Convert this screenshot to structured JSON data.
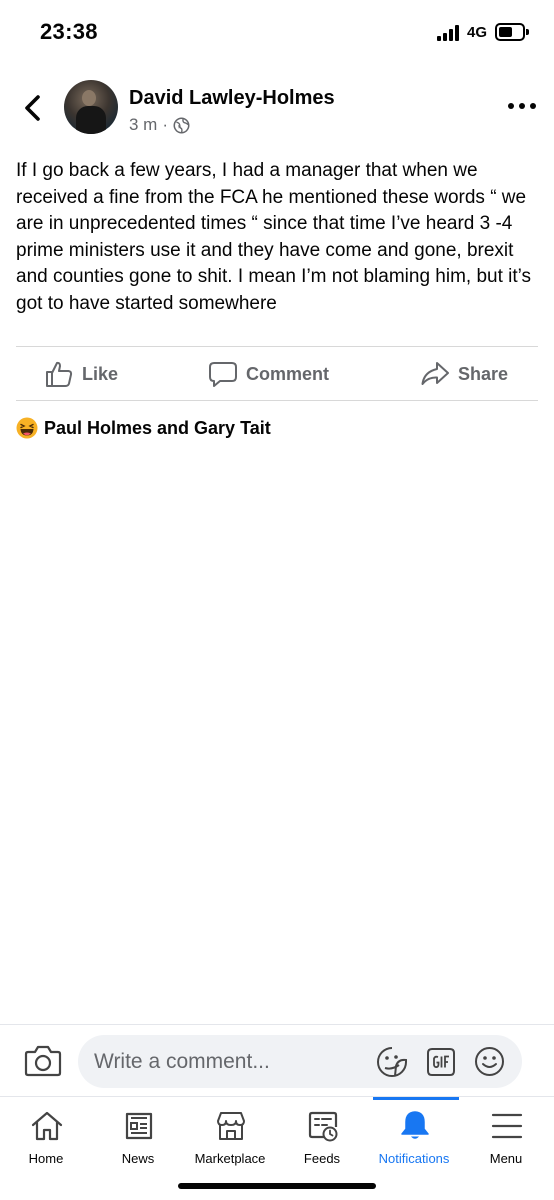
{
  "status_bar": {
    "time": "23:38",
    "network": "4G"
  },
  "post": {
    "author": "David Lawley-Holmes",
    "time": "3 m",
    "separator": "·",
    "text": "If I go back a few years, I had a manager that when we received a fine from the FCA he mentioned these words “ we are in unprecedented times “ since that time I’ve heard 3 -4 prime ministers use it and they have come and gone, brexit and counties gone to shit. I mean I’m not blaming him, but it’s got to have started somewhere",
    "actions": {
      "like": "Like",
      "comment": "Comment",
      "share": "Share"
    },
    "reactions": {
      "icon": "haha-icon",
      "people": "Paul Holmes and Gary Tait"
    }
  },
  "composer": {
    "placeholder": "Write a comment..."
  },
  "bottom_nav": {
    "items": [
      {
        "label": "Home",
        "icon": "home-icon"
      },
      {
        "label": "News",
        "icon": "news-icon"
      },
      {
        "label": "Marketplace",
        "icon": "marketplace-icon"
      },
      {
        "label": "Feeds",
        "icon": "feeds-icon"
      },
      {
        "label": "Notifications",
        "icon": "bell-icon",
        "active": true
      },
      {
        "label": "Menu",
        "icon": "menu-icon"
      }
    ]
  },
  "colors": {
    "accent": "#1877f2",
    "secondary_text": "#65676b",
    "haha": "#f7b125"
  }
}
